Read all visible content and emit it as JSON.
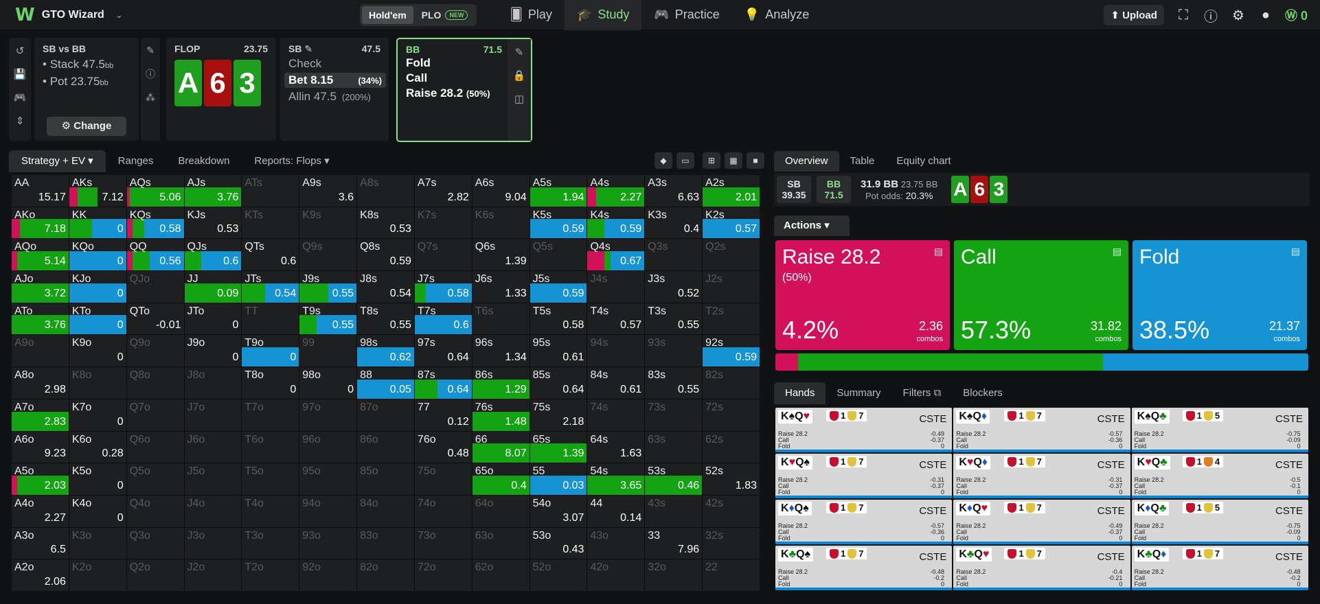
{
  "app": {
    "name": "GTO Wizard",
    "logo": "W",
    "game_toggle": [
      "Hold'em",
      "PLO"
    ],
    "new_badge": "NEW",
    "nav": [
      "Play",
      "Study",
      "Practice",
      "Analyze"
    ],
    "upload": "Upload",
    "coins": "0"
  },
  "spot": {
    "title": "SB vs BB",
    "stack": "Stack 47.5",
    "pot": "Pot 23.75",
    "unit": "bb",
    "change": "Change"
  },
  "flop": {
    "label": "FLOP",
    "pot": "23.75",
    "cards": [
      "A",
      "6",
      "3"
    ]
  },
  "sb": {
    "label": "SB",
    "stack": "47.5",
    "actions": [
      {
        "name": "Check",
        "pct": ""
      },
      {
        "name": "Bet 8.15",
        "pct": "(34%)"
      },
      {
        "name": "Allin 47.5",
        "pct": "(200%)"
      }
    ]
  },
  "bb": {
    "label": "BB",
    "stack": "71.5",
    "actions": [
      {
        "name": "Fold",
        "pct": ""
      },
      {
        "name": "Call",
        "pct": ""
      },
      {
        "name": "Raise 28.2",
        "pct": "(50%)"
      }
    ]
  },
  "grid_tabs": [
    "Strategy + EV",
    "Ranges",
    "Breakdown",
    "Reports: Flops"
  ],
  "overview_tabs": [
    "Overview",
    "Table",
    "Equity chart"
  ],
  "overview": {
    "sb_label": "SB",
    "sb_stack": "39.35",
    "bb_label": "BB",
    "bb_stack": "71.5",
    "to_call": "31.9 BB",
    "pot": "23.75 BB",
    "pot_odds_label": "Pot odds:",
    "pot_odds": "20.3%"
  },
  "actions_label": "Actions",
  "action_boxes": [
    {
      "label": "Raise 28.2",
      "sub": "(50%)",
      "pct": "4.2%",
      "combos": "2.36",
      "color": "#d3105a"
    },
    {
      "label": "Call",
      "sub": "",
      "pct": "57.3%",
      "combos": "31.82",
      "color": "#13a313"
    },
    {
      "label": "Fold",
      "sub": "",
      "pct": "38.5%",
      "combos": "21.37",
      "color": "#1593d3"
    }
  ],
  "combos_word": "combos",
  "freq": {
    "raise": 4.2,
    "call": 57.3,
    "fold": 38.5
  },
  "colors": {
    "raise": "#d3105a",
    "call": "#13a313",
    "fold": "#1593d3",
    "accent": "#8be08a"
  },
  "hand_tabs": [
    "Hands",
    "Summary",
    "Filters",
    "Blockers"
  ],
  "hands": [
    {
      "hand": "K♠Q♥",
      "b1": "1",
      "b2": "7",
      "tag": "CSTE",
      "r": "-0.49",
      "c": "-0.37",
      "f": "0"
    },
    {
      "hand": "K♠Q♦",
      "b1": "1",
      "b2": "7",
      "tag": "CSTE",
      "r": "-0.57",
      "c": "-0.36",
      "f": "0"
    },
    {
      "hand": "K♠Q♣",
      "b1": "1",
      "b2": "5",
      "tag": "CSTE",
      "r": "-0.75",
      "c": "-0.09",
      "f": "0"
    },
    {
      "hand": "K♥Q♠",
      "b1": "1",
      "b2": "7",
      "tag": "CSTE",
      "r": "-0.31",
      "c": "-0.37",
      "f": "0"
    },
    {
      "hand": "K♥Q♦",
      "b1": "1",
      "b2": "7",
      "tag": "CSTE",
      "r": "-0.31",
      "c": "-0.37",
      "f": "0"
    },
    {
      "hand": "K♥Q♣",
      "b1": "1",
      "b2": "4",
      "tag": "CSTE",
      "r": "-0.5",
      "c": "-0.1",
      "f": "0"
    },
    {
      "hand": "K♦Q♠",
      "b1": "1",
      "b2": "7",
      "tag": "CSTE",
      "r": "-0.57",
      "c": "-0.36",
      "f": "0"
    },
    {
      "hand": "K♦Q♥",
      "b1": "1",
      "b2": "7",
      "tag": "CSTE",
      "r": "-0.49",
      "c": "-0.37",
      "f": "0"
    },
    {
      "hand": "K♦Q♣",
      "b1": "1",
      "b2": "5",
      "tag": "CSTE",
      "r": "-0.75",
      "c": "-0.09",
      "f": "0"
    },
    {
      "hand": "K♣Q♠",
      "b1": "1",
      "b2": "7",
      "tag": "CSTE",
      "r": "-0.48",
      "c": "-0.2",
      "f": "0"
    },
    {
      "hand": "K♣Q♥",
      "b1": "1",
      "b2": "7",
      "tag": "CSTE",
      "r": "-0.4",
      "c": "-0.21",
      "f": "0"
    },
    {
      "hand": "K♣Q♦",
      "b1": "1",
      "b2": "7",
      "tag": "CSTE",
      "r": "-0.48",
      "c": "-0.2",
      "f": "0"
    }
  ],
  "hand_row_labels": {
    "raise": "Raise 28.2",
    "call": "Call",
    "fold": "Fold"
  },
  "grid": [
    [
      "AA|15.17",
      "AKs|7.12|15,35,0",
      "AQs|5.06|5,95,0",
      "AJs|3.76|0,100,0",
      "ATs|",
      "A9s|3.6",
      "A8s|",
      "A7s|2.82",
      "A6s|9.04",
      "A5s|1.94|0,100,0",
      "A4s|2.27|15,85,0",
      "A3s|6.63",
      "A2s|2.01|0,100,0"
    ],
    [
      "AKo|7.18|15,85,0",
      "KK|0|0,40,60",
      "KQs|0.58|10,20,70",
      "KJs|0.53",
      "KTs|",
      "K9s|",
      "K8s|0.53",
      "K7s|",
      "K6s|",
      "K5s|0.59|0,0,100",
      "K4s|0.59|0,30,70",
      "K3s|0.4",
      "K2s|0.57|0,0,100"
    ],
    [
      "AQo|5.14|10,90,0",
      "KQo|0|0,0,100",
      "QQ|0.56|10,30,60",
      "QJs|0.6|0,30,70",
      "QTs|0.6",
      "Q9s|",
      "Q8s|0.59",
      "Q7s|",
      "Q6s|1.39",
      "Q5s|",
      "Q4s|0.67|30,10,60",
      "Q3s|",
      "Q2s|"
    ],
    [
      "AJo|3.72|0,100,0",
      "KJo|0|0,0,100",
      "QJo|",
      "JJ|0.09|0,100,0",
      "JTs|0.54|0,40,60",
      "J9s|0.55|0,50,50",
      "J8s|0.54",
      "J7s|0.58|0,20,80",
      "J6s|1.33",
      "J5s|0.59|0,0,100",
      "J4s|",
      "J3s|0.52",
      "J2s|"
    ],
    [
      "ATo|3.76|0,100,0",
      "KTo|0|0,0,100",
      "QTo|-0.01",
      "JTo|0",
      "TT|",
      "T9s|0.55|0,30,70",
      "T8s|0.55",
      "T7s|0.6|0,0,100",
      "T6s|",
      "T5s|0.58",
      "T4s|0.57",
      "T3s|0.55",
      "T2s|"
    ],
    [
      "A9o|",
      "K9o|0",
      "Q9o|",
      "J9o|0",
      "T9o|0|0,0,100",
      "99|",
      "98s|0.62|0,0,100",
      "97s|0.64",
      "96s|1.34",
      "95s|0.61",
      "94s|",
      "93s|",
      "92s|0.59|0,0,100"
    ],
    [
      "A8o|2.98",
      "K8o|",
      "Q8o|",
      "J8o|",
      "T8o|0",
      "98o|0",
      "88|0.05|0,0,100",
      "87s|0.64|0,40,60",
      "86s|1.29|0,100,0",
      "85s|0.64",
      "84s|0.61",
      "83s|0.55",
      "82s|"
    ],
    [
      "A7o|2.83|0,100,0",
      "K7o|0",
      "Q7o|",
      "J7o|",
      "T7o|",
      "97o|",
      "87o|",
      "77|0.12",
      "76s|1.48|0,100,0",
      "75s|2.18",
      "74s|",
      "73s|",
      "72s|"
    ],
    [
      "A6o|9.23",
      "K6o|0.28",
      "Q6o|",
      "J6o|",
      "T6o|",
      "96o|",
      "86o|",
      "76o|0.48",
      "66|8.07|0,100,0",
      "65s|1.39|0,100,0",
      "64s|1.63",
      "63s|",
      "62s|"
    ],
    [
      "A5o|2.03|10,90,0",
      "K5o|0",
      "Q5o|",
      "J5o|",
      "T5o|",
      "95o|",
      "85o|",
      "75o|",
      "65o|0.4|0,100,0",
      "55|0.03|0,0,100",
      "54s|3.65|0,100,0",
      "53s|0.46|0,100,0",
      "52s|1.83"
    ],
    [
      "A4o|2.27",
      "K4o|0",
      "Q4o|",
      "J4o|",
      "T4o|",
      "94o|",
      "84o|",
      "74o|",
      "64o|",
      "54o|3.07",
      "44|0.14",
      "43s|",
      "42s|"
    ],
    [
      "A3o|6.5",
      "K3o|",
      "Q3o|",
      "J3o|",
      "T3o|",
      "93o|",
      "83o|",
      "73o|",
      "63o|",
      "53o|0.43",
      "43o|",
      "33|7.96",
      "32s|"
    ],
    [
      "A2o|2.06",
      "K2o|",
      "Q2o|",
      "J2o|",
      "T2o|",
      "92o|",
      "82o|",
      "72o|",
      "62o|",
      "52o|",
      "42o|",
      "32o|",
      "22|"
    ]
  ]
}
